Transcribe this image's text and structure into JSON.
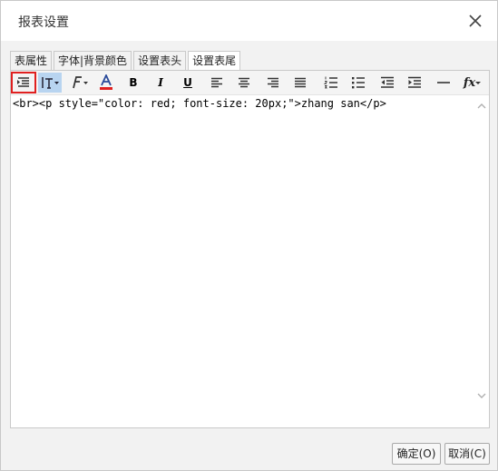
{
  "dialog": {
    "title": "报表设置"
  },
  "tabs": [
    {
      "label": "表属性"
    },
    {
      "label": "字体|背景颜色"
    },
    {
      "label": "设置表头"
    },
    {
      "label": "设置表尾",
      "active": true
    }
  ],
  "toolbar": {
    "items": [
      "source-icon",
      "font-size-icon",
      "font-family-icon",
      "font-color-icon",
      "bold-icon",
      "italic-icon",
      "underline-icon",
      "align-left-icon",
      "align-center-icon",
      "align-right-icon",
      "align-justify-icon",
      "ordered-list-icon",
      "unordered-list-icon",
      "outdent-icon",
      "indent-icon",
      "horizontal-rule-icon",
      "formula-icon"
    ],
    "selected": "font-size-icon",
    "highlighted": "source-icon",
    "bold_glyph": "B",
    "italic_glyph": "I",
    "underline_glyph": "U",
    "formula_glyph": "fx"
  },
  "editor": {
    "content": "<br><p style=\"color: red; font-size: 20px;\">zhang san</p>"
  },
  "buttons": {
    "ok_label": "确定(O)",
    "cancel_label": "取消(C)"
  },
  "colors": {
    "highlight": "#e02020",
    "selected": "#b8d4f0",
    "font_color_bar": "#e02020"
  }
}
